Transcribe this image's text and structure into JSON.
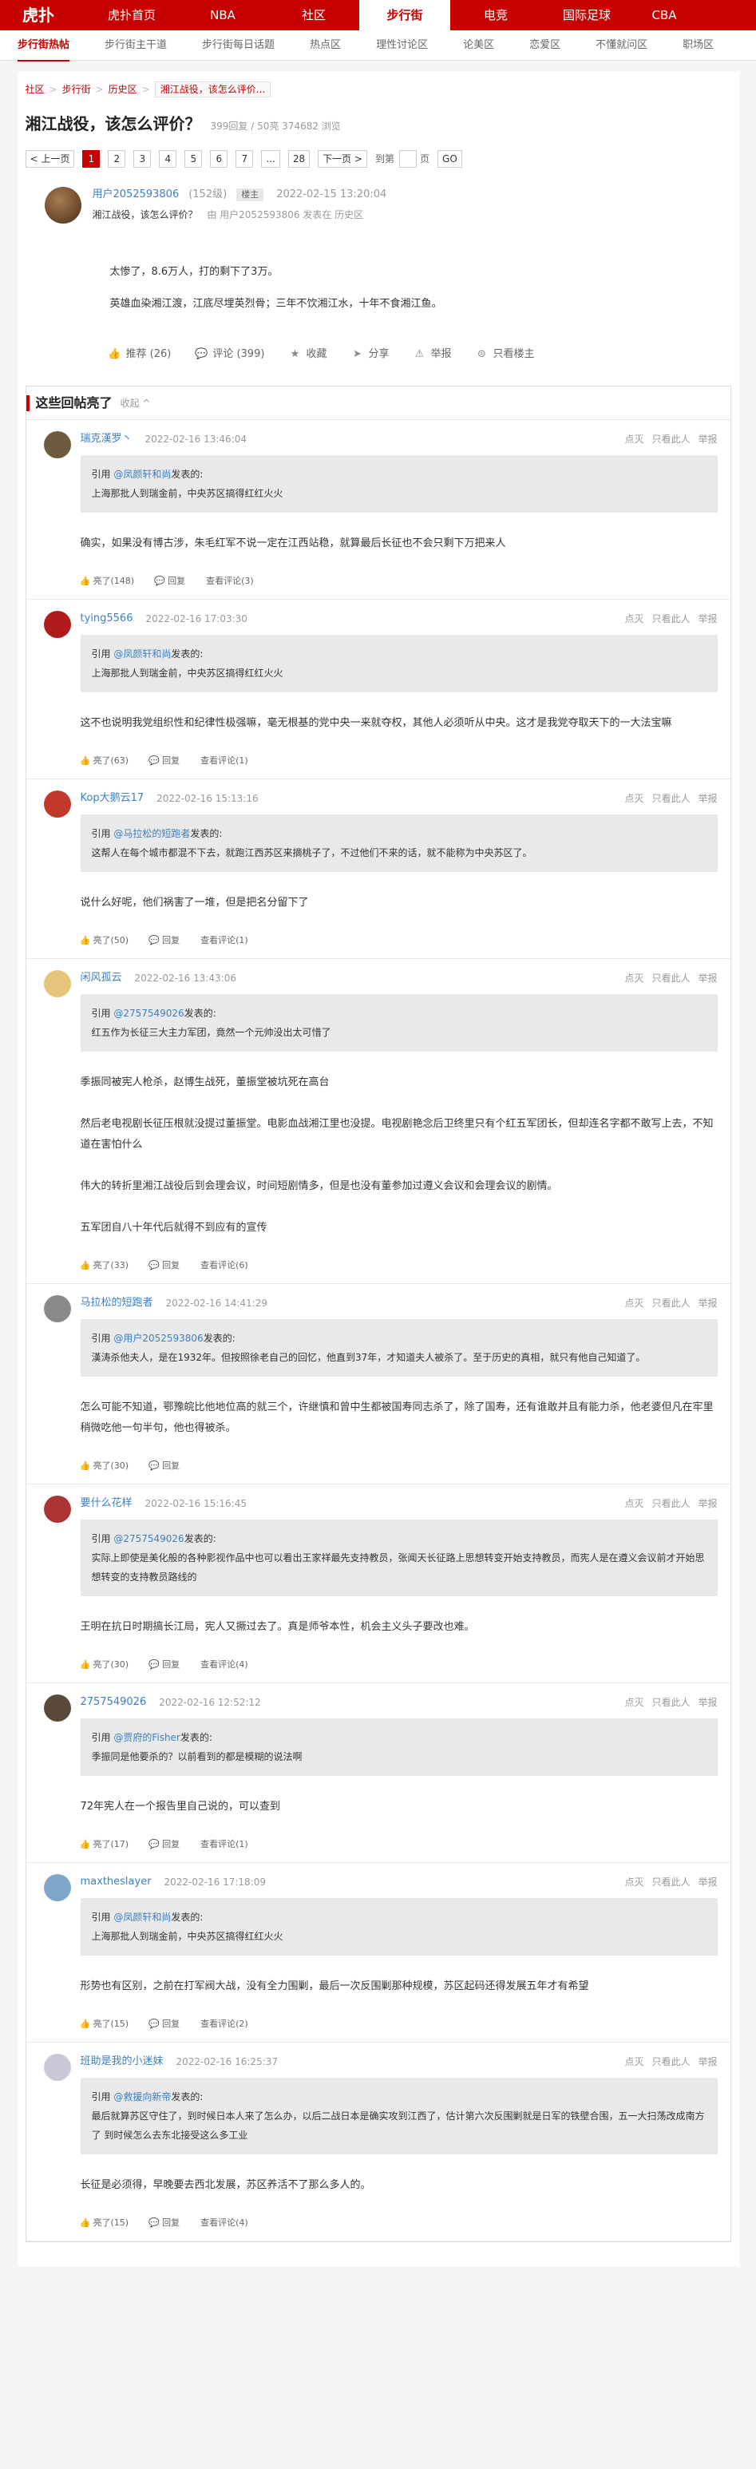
{
  "topnav": {
    "logo": "虎扑",
    "items": [
      "虎扑首页",
      "NBA",
      "社区",
      "步行街",
      "电竞",
      "国际足球",
      "CBA"
    ],
    "active_index": 3
  },
  "subnav": {
    "items": [
      "步行街热帖",
      "步行街主干道",
      "步行街每日话题",
      "热点区",
      "理性讨论区",
      "论美区",
      "恋爱区",
      "不懂就问区",
      "职场区"
    ],
    "active_index": 0
  },
  "breadcrumb": [
    "社区",
    "步行街",
    "历史区",
    "湘江战役，该怎么评价..."
  ],
  "thread": {
    "title": "湘江战役，该怎么评价？",
    "stats": "399回复 / 50亮 374682 浏览"
  },
  "pager": {
    "prev": "< 上一页",
    "pages": [
      "1",
      "2",
      "3",
      "4",
      "5",
      "6",
      "7",
      "...",
      "28"
    ],
    "next": "下一页 >",
    "goto": "到第",
    "page_unit": "页",
    "go": "GO"
  },
  "main_post": {
    "user": "用户2052593806",
    "level": "(152级)",
    "badge": "楼主",
    "time": "2022-02-15 13:20:04",
    "subtitle": "湘江战役，该怎么评价？",
    "from": "由 用户2052593806 发表在 历史区",
    "content": [
      "太惨了，8.6万人，打的剩下了3万。",
      "英雄血染湘江渡，江底尽埋英烈骨；三年不饮湘江水，十年不食湘江鱼。"
    ],
    "actions": {
      "recommend": "推荐 (26)",
      "comment": "评论 (399)",
      "favorite": "收藏",
      "share": "分享",
      "report": "举报",
      "only_op": "只看楼主"
    }
  },
  "highlight": {
    "title": "这些回帖亮了",
    "collapse": "收起 ^",
    "tools": [
      "点灭",
      "只看此人",
      "举报"
    ],
    "reply_label": "回复",
    "replies": [
      {
        "user": "瑞克漢罗丶",
        "time": "2022-02-16 13:46:04",
        "avatar_color": "#6d5a3f",
        "quote_user": "@凤颜轩和尚",
        "quote_suffix": "发表的:",
        "quote_text": "上海那批人到瑞金前，中央苏区搞得红红火火",
        "content": [
          "确实，如果没有博古涉，朱毛红军不说一定在江西站稳，就算最后长征也不会只剩下万把来人"
        ],
        "light": "亮了(148)",
        "comments": "查看评论(3)"
      },
      {
        "user": "tying5566",
        "time": "2022-02-16 17:03:30",
        "avatar_color": "#b01b1b",
        "quote_user": "@凤颜轩和尚",
        "quote_suffix": "发表的:",
        "quote_text": "上海那批人到瑞金前，中央苏区搞得红红火火",
        "content": [
          "这不也说明我党组织性和纪律性极强嘛，毫无根基的党中央一来就夺权，其他人必须听从中央。这才是我党夺取天下的一大法宝嘛"
        ],
        "light": "亮了(63)",
        "comments": "查看评论(1)"
      },
      {
        "user": "Kop大鹅云17",
        "time": "2022-02-16 15:13:16",
        "avatar_color": "#c0392b",
        "quote_user": "@马拉松的短跑者",
        "quote_suffix": "发表的:",
        "quote_text": "这帮人在每个城市都混不下去，就跑江西苏区来摘桃子了，不过他们不来的话，就不能称为中央苏区了。",
        "content": [
          "说什么好呢，他们祸害了一堆，但是把名分留下了"
        ],
        "light": "亮了(50)",
        "comments": "查看评论(1)"
      },
      {
        "user": "闲风孤云",
        "time": "2022-02-16 13:43:06",
        "avatar_color": "#e6c57a",
        "quote_user": "@2757549026",
        "quote_suffix": "发表的:",
        "quote_text": "红五作为长征三大主力军团，竟然一个元帅没出太可惜了",
        "content": [
          "季振同被宪人枪杀，赵博生战死，董振堂被坑死在高台",
          "然后老电视剧长征压根就没提过董振堂。电影血战湘江里也没提。电视剧艳念后卫终里只有个红五军团长，但却连名字都不敢写上去，不知道在害怕什么",
          "伟大的转折里湘江战役后到会理会议，时间短剧情多，但是也没有董参加过遵义会议和会理会议的剧情。",
          "五军团自八十年代后就得不到应有的宣传"
        ],
        "light": "亮了(33)",
        "comments": "查看评论(6)"
      },
      {
        "user": "马拉松的短跑者",
        "time": "2022-02-16 14:41:29",
        "avatar_color": "#8a8a8a",
        "quote_user": "@用户2052593806",
        "quote_suffix": "发表的:",
        "quote_text": "漢涛杀他夫人，是在1932年。但按照徐老自己的回忆，他直到37年，才知道夫人被杀了。至于历史的真相，就只有他自己知道了。",
        "content": [
          "怎么可能不知道，鄂豫皖比他地位高的就三个，许继慎和曾中生都被国寿同志杀了，除了国寿，还有谁敢并且有能力杀，他老婆但凡在牢里稍微吃他一句半句，他也得被杀。"
        ],
        "light": "亮了(30)",
        "comments": ""
      },
      {
        "user": "要什么花样",
        "time": "2022-02-16 15:16:45",
        "avatar_color": "#a33",
        "quote_user": "@2757549026",
        "quote_suffix": "发表的:",
        "quote_text": "实际上即使是美化般的各种影视作品中也可以看出王家祥最先支持教员，张闻天长征路上思想转变开始支持教员，而宪人是在遵义会议前才开始思想转变的支持教员路线的",
        "content": [
          "王明在抗日时期搞长江局，宪人又撅过去了。真是师爷本性，机会主义头子要改也难。"
        ],
        "light": "亮了(30)",
        "comments": "查看评论(4)"
      },
      {
        "user": "2757549026",
        "time": "2022-02-16 12:52:12",
        "avatar_color": "#5a4a3a",
        "quote_user": "@贾府的Fisher",
        "quote_suffix": "发表的:",
        "quote_text": "季振同是他要杀的？以前看到的都是模糊的说法啊",
        "content": [
          "72年宪人在一个报告里自己说的，可以查到"
        ],
        "light": "亮了(17)",
        "comments": "查看评论(1)"
      },
      {
        "user": "maxtheslayer",
        "time": "2022-02-16 17:18:09",
        "avatar_color": "#7fa6c9",
        "quote_user": "@凤颜轩和尚",
        "quote_suffix": "发表的:",
        "quote_text": "上海那批人到瑞金前，中央苏区搞得红红火火",
        "content": [
          "形势也有区别，之前在打军阀大战，没有全力围剿，最后一次反围剿那种规模，苏区起码还得发展五年才有希望"
        ],
        "light": "亮了(15)",
        "comments": "查看评论(2)"
      },
      {
        "user": "班助是我的小迷妹",
        "time": "2022-02-16 16:25:37",
        "avatar_color": "#c8c8d8",
        "quote_user": "@救援向新帝",
        "quote_suffix": "发表的:",
        "quote_text": "最后就算苏区守住了，到时候日本人来了怎么办，以后二战日本是确实攻到江西了，估计第六次反围剿就是日军的铁壁合围，五一大扫荡改成南方了 到时候怎么去东北接受这么多工业",
        "content": [
          "长征是必须得，早晚要去西北发展，苏区养活不了那么多人的。"
        ],
        "light": "亮了(15)",
        "comments": "查看评论(4)"
      }
    ]
  }
}
